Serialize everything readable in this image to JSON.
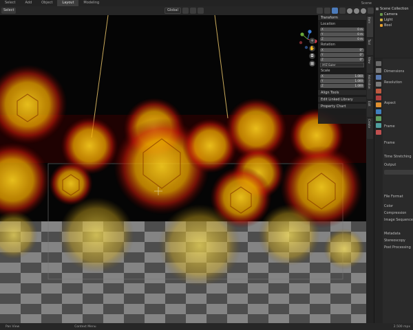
{
  "top_menu": {
    "items": [
      "Select",
      "Add",
      "Object"
    ],
    "workspace_tabs": [
      "Layout",
      "Modeling"
    ],
    "active_tab": "Layout",
    "scene_label": "Scene"
  },
  "viewport_header": {
    "orientation": "Global",
    "snap_label": "Local"
  },
  "n_panel": {
    "transform": {
      "title": "Transform",
      "location_label": "Location",
      "location": [
        {
          "axis": "X",
          "value": "0 m"
        },
        {
          "axis": "Y",
          "value": "0 m"
        },
        {
          "axis": "Z",
          "value": "0 m"
        }
      ],
      "rotation_label": "Rotation",
      "rotation": [
        {
          "axis": "X",
          "value": "0°"
        },
        {
          "axis": "Y",
          "value": "0°"
        },
        {
          "axis": "Z",
          "value": "0°"
        }
      ],
      "rotation_mode": "XYZ Euler",
      "scale_label": "Scale",
      "scale": [
        {
          "axis": "X",
          "value": "1.000"
        },
        {
          "axis": "Y",
          "value": "1.000"
        },
        {
          "axis": "Z",
          "value": "1.000"
        }
      ]
    },
    "collapsed_panels": [
      "Align Tools",
      "Edit Linked Library",
      "Property Chart"
    ]
  },
  "vertical_tabs": [
    "Item",
    "Tool",
    "View",
    "Animation",
    "Edit",
    "Create"
  ],
  "outliner": {
    "items": [
      {
        "label": "Scene Collection"
      },
      {
        "label": "Camera"
      },
      {
        "label": "Light"
      },
      {
        "label": "Bool"
      }
    ]
  },
  "properties": {
    "title": "Dimensions",
    "rows": [
      "Resolution",
      "Aspect",
      "Frame",
      "Frame",
      "Time Stretching",
      "Output",
      "File Format",
      "Color",
      "Compression",
      "Image Sequence",
      "Metadata",
      "Stereoscopy",
      "Post Processing"
    ]
  },
  "statusbar": {
    "left_item": "Pan View",
    "mid_item": "Context Menu",
    "right_text": "2.500 mpx"
  },
  "colors": {
    "accent_blue": "#4c7bbb",
    "crystal_yellow": "#ffd21e",
    "glow_red": "#c81a0a"
  },
  "icons": [
    "menu-icon",
    "gear-icon",
    "hand-icon",
    "zoom-icon",
    "camera-icon",
    "grid-icon",
    "eye-icon"
  ]
}
